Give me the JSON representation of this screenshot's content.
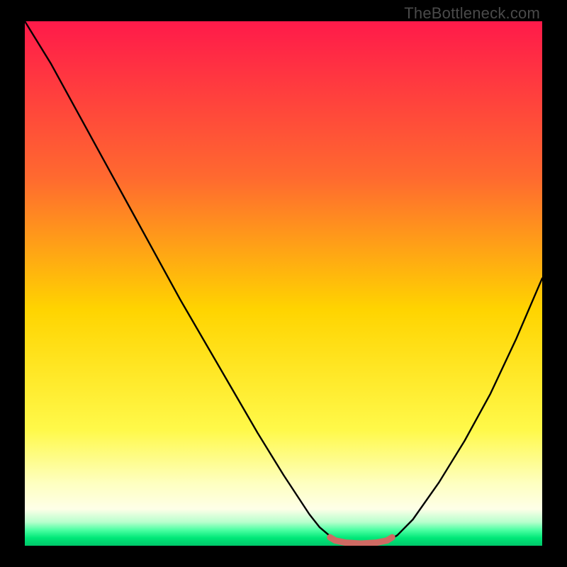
{
  "watermark": "TheBottleneck.com",
  "chart_data": {
    "type": "line",
    "title": "",
    "xlabel": "",
    "ylabel": "",
    "xlim": [
      0,
      1
    ],
    "ylim": [
      0,
      1
    ],
    "background_gradient_stops": [
      {
        "offset": 0.0,
        "color": "#ff1a4a"
      },
      {
        "offset": 0.3,
        "color": "#ff6a2f"
      },
      {
        "offset": 0.55,
        "color": "#ffd400"
      },
      {
        "offset": 0.78,
        "color": "#fff94a"
      },
      {
        "offset": 0.88,
        "color": "#feffbf"
      },
      {
        "offset": 0.93,
        "color": "#feffe8"
      },
      {
        "offset": 0.955,
        "color": "#b7ffcd"
      },
      {
        "offset": 0.97,
        "color": "#4cffa3"
      },
      {
        "offset": 0.985,
        "color": "#00e878"
      },
      {
        "offset": 1.0,
        "color": "#00c76a"
      }
    ],
    "series": [
      {
        "name": "curve",
        "x": [
          0.0,
          0.05,
          0.1,
          0.15,
          0.2,
          0.25,
          0.3,
          0.35,
          0.4,
          0.45,
          0.5,
          0.55,
          0.57,
          0.6,
          0.64,
          0.68,
          0.7,
          0.72,
          0.75,
          0.8,
          0.85,
          0.9,
          0.95,
          1.0
        ],
        "y": [
          1.0,
          0.92,
          0.83,
          0.74,
          0.65,
          0.56,
          0.47,
          0.385,
          0.3,
          0.215,
          0.135,
          0.06,
          0.035,
          0.01,
          0.004,
          0.004,
          0.008,
          0.02,
          0.05,
          0.12,
          0.2,
          0.29,
          0.395,
          0.51
        ]
      },
      {
        "name": "plateau-marker",
        "x": [
          0.59,
          0.6,
          0.62,
          0.65,
          0.68,
          0.7,
          0.71
        ],
        "y": [
          0.016,
          0.01,
          0.006,
          0.004,
          0.006,
          0.01,
          0.016
        ]
      }
    ],
    "colors": {
      "curve": "#000000",
      "plateau": "#cf6a63"
    }
  }
}
